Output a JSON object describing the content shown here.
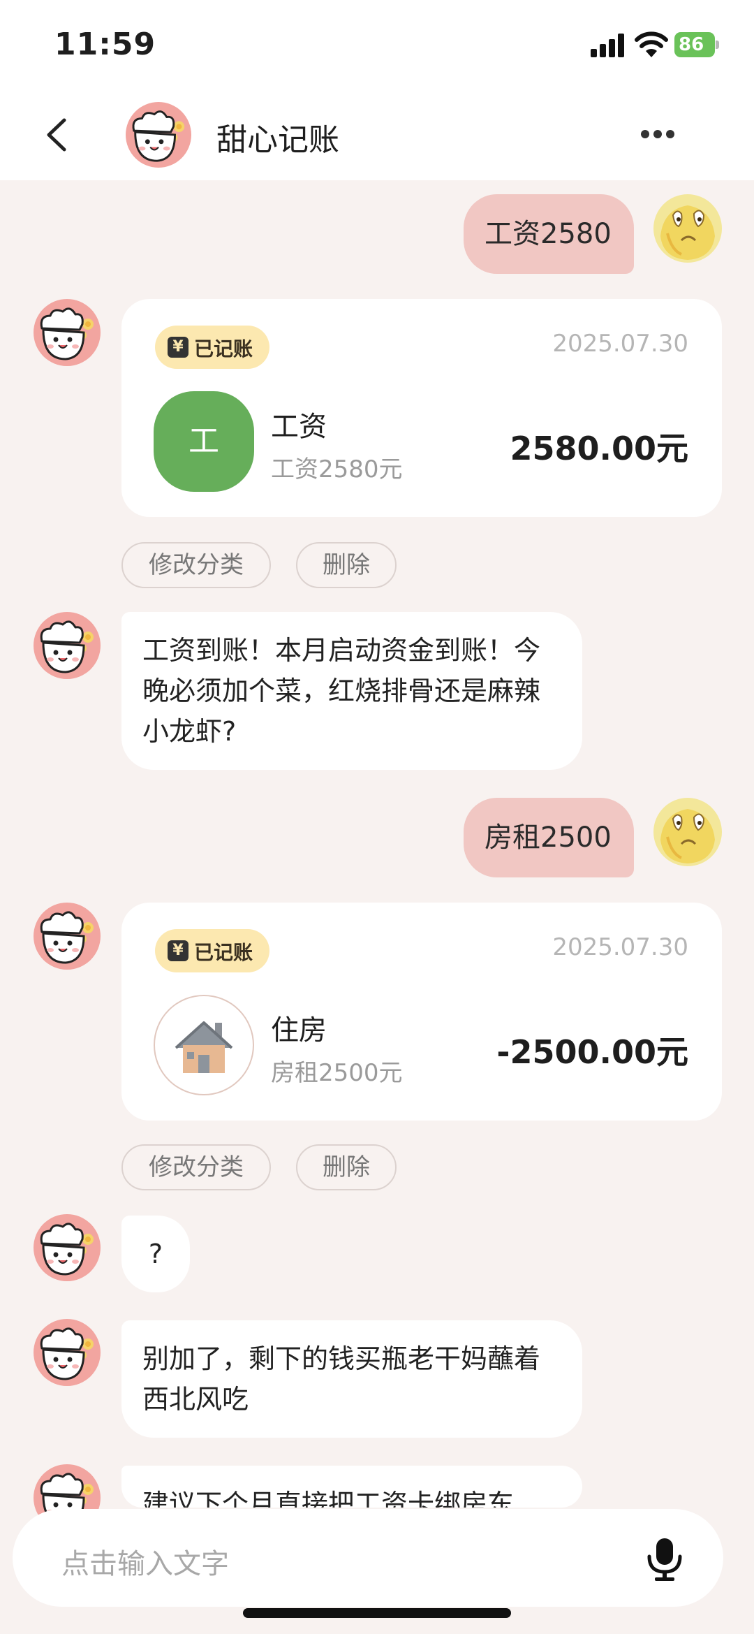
{
  "status": {
    "time": "11:59",
    "battery": "86"
  },
  "header": {
    "title": "甜心记账"
  },
  "messages": {
    "u1": "工资2580",
    "c1": {
      "badge": "已记账",
      "date": "2025.07.30",
      "icon_text": "工",
      "category": "工资",
      "desc": "工资2580元",
      "amount": "2580.00元"
    },
    "b1": "工资到账！本月启动资金到账！今晚必须加个菜，红烧排骨还是麻辣小龙虾?",
    "u2": "房租2500",
    "c2": {
      "badge": "已记账",
      "date": "2025.07.30",
      "icon": "house-icon",
      "category": "住房",
      "desc": "房租2500元",
      "amount": "-2500.00元"
    },
    "b2": "?",
    "b3": "别加了，剩下的钱买瓶老干妈蘸着西北风吃",
    "b4": "建议下个月直接把工资卡绑房东"
  },
  "actions": {
    "edit": "修改分类",
    "delete": "删除"
  },
  "input": {
    "placeholder": "点击输入文字"
  },
  "colors": {
    "user_bubble": "#f1c7c3",
    "badge": "#fce8b0",
    "salary_icon": "#66ae5a",
    "background": "#f8f2f0"
  }
}
